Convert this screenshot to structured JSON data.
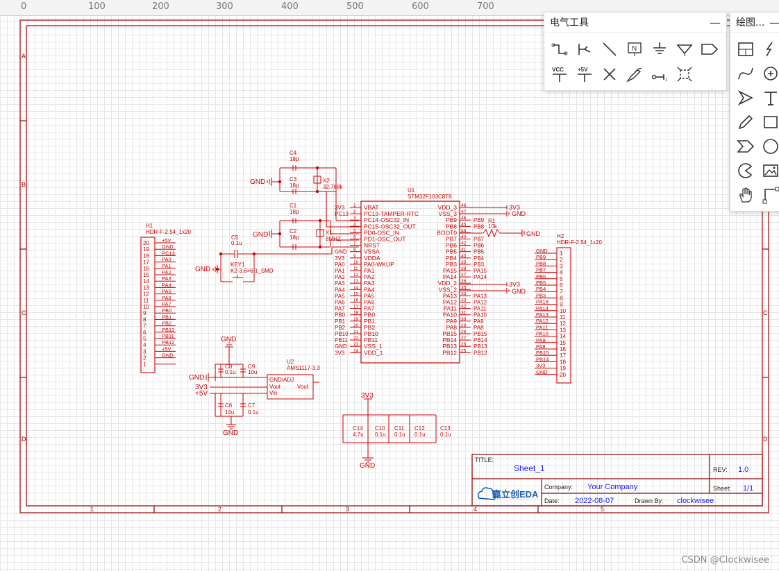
{
  "ruler": {
    "labels": [
      "0",
      "100",
      "200",
      "300",
      "400",
      "500",
      "600",
      "700"
    ]
  },
  "frame": {
    "rows": [
      "A",
      "B",
      "C",
      "D"
    ],
    "cols": [
      "1",
      "2",
      "3",
      "4",
      "5"
    ]
  },
  "title_block": {
    "title_label": "TITLE:",
    "title": "Sheet_1",
    "rev_label": "REV:",
    "rev": "1.0",
    "company_label": "Company:",
    "company": "Your Company",
    "sheet_label": "Sheet:",
    "sheet": "1/1",
    "date_label": "Date:",
    "date": "2022-08-07",
    "drawn_label": "Drawn By:",
    "drawn": "clockwisee",
    "logo": "嘉立创EDA"
  },
  "u1": {
    "ref": "U1",
    "part": "STM32F103C8T6",
    "left_pins": [
      {
        "num": "1",
        "name": "VBAT",
        "net": "3V3"
      },
      {
        "num": "2",
        "name": "PC13-TAMPER-RTC",
        "net": "PC13"
      },
      {
        "num": "3",
        "name": "PC14-OSC32_IN",
        "net": ""
      },
      {
        "num": "4",
        "name": "PC15-OSC32_OUT",
        "net": ""
      },
      {
        "num": "5",
        "name": "PD0-OSC_IN",
        "net": ""
      },
      {
        "num": "6",
        "name": "PD1-OSC_OUT",
        "net": ""
      },
      {
        "num": "7",
        "name": "NRST",
        "net": ""
      },
      {
        "num": "8",
        "name": "VSSA",
        "net": "GND"
      },
      {
        "num": "9",
        "name": "VDDA",
        "net": "3V3"
      },
      {
        "num": "10",
        "name": "PA0-WKUP",
        "net": "PA0"
      },
      {
        "num": "11",
        "name": "PA1",
        "net": "PA1"
      },
      {
        "num": "12",
        "name": "PA2",
        "net": "PA2"
      },
      {
        "num": "13",
        "name": "PA3",
        "net": "PA3"
      },
      {
        "num": "14",
        "name": "PA4",
        "net": "PA4"
      },
      {
        "num": "15",
        "name": "PA5",
        "net": "PA5"
      },
      {
        "num": "16",
        "name": "PA6",
        "net": "PA6"
      },
      {
        "num": "17",
        "name": "PA7",
        "net": "PA7"
      },
      {
        "num": "18",
        "name": "PB0",
        "net": "PB0"
      },
      {
        "num": "19",
        "name": "PB1",
        "net": "PB1"
      },
      {
        "num": "20",
        "name": "PB2",
        "net": "PB2"
      },
      {
        "num": "21",
        "name": "PB10",
        "net": "PB10"
      },
      {
        "num": "22",
        "name": "PB11",
        "net": "PB11"
      },
      {
        "num": "23",
        "name": "VSS_1",
        "net": "GND"
      },
      {
        "num": "24",
        "name": "VDD_1",
        "net": "3V3"
      }
    ],
    "right_pins": [
      {
        "num": "48",
        "name": "VDD_3",
        "net": "3V3"
      },
      {
        "num": "47",
        "name": "VSS_3",
        "net": "GND"
      },
      {
        "num": "46",
        "name": "PB9",
        "net": "PB9"
      },
      {
        "num": "45",
        "name": "PB8",
        "net": "PB8"
      },
      {
        "num": "44",
        "name": "BOOT0",
        "net": ""
      },
      {
        "num": "43",
        "name": "PB7",
        "net": "PB7"
      },
      {
        "num": "42",
        "name": "PB6",
        "net": "PB6"
      },
      {
        "num": "41",
        "name": "PB5",
        "net": "PB5"
      },
      {
        "num": "40",
        "name": "PB4",
        "net": "PB4"
      },
      {
        "num": "39",
        "name": "PB3",
        "net": "PB3"
      },
      {
        "num": "38",
        "name": "PA15",
        "net": "PA15"
      },
      {
        "num": "37",
        "name": "PA14",
        "net": "PA14"
      },
      {
        "num": "36",
        "name": "VDD_2",
        "net": "3V3"
      },
      {
        "num": "35",
        "name": "VSS_2",
        "net": "GND"
      },
      {
        "num": "34",
        "name": "PA13",
        "net": "PA13"
      },
      {
        "num": "33",
        "name": "PA12",
        "net": "PA12"
      },
      {
        "num": "32",
        "name": "PA11",
        "net": "PA11"
      },
      {
        "num": "31",
        "name": "PA10",
        "net": "PA10"
      },
      {
        "num": "30",
        "name": "PA9",
        "net": "PA9"
      },
      {
        "num": "29",
        "name": "PA8",
        "net": "PA8"
      },
      {
        "num": "28",
        "name": "PB15",
        "net": "PB15"
      },
      {
        "num": "27",
        "name": "PB14",
        "net": "PB14"
      },
      {
        "num": "26",
        "name": "PB13",
        "net": "PB13"
      },
      {
        "num": "25",
        "name": "PB12",
        "net": "PB12"
      }
    ]
  },
  "h1": {
    "ref": "H1",
    "part": "HDR-F-2.54_1x20",
    "pins": [
      {
        "num": "20",
        "net": "+5V"
      },
      {
        "num": "19",
        "net": "GND"
      },
      {
        "num": "18",
        "net": "PC13"
      },
      {
        "num": "17",
        "net": "PA0"
      },
      {
        "num": "16",
        "net": "PA1"
      },
      {
        "num": "15",
        "net": "PA2"
      },
      {
        "num": "14",
        "net": "PA3"
      },
      {
        "num": "13",
        "net": "PA4"
      },
      {
        "num": "12",
        "net": "PA5"
      },
      {
        "num": "11",
        "net": "PA6"
      },
      {
        "num": "10",
        "net": "PA7"
      },
      {
        "num": "9",
        "net": "PB0"
      },
      {
        "num": "8",
        "net": "PB1"
      },
      {
        "num": "7",
        "net": "PB2"
      },
      {
        "num": "6",
        "net": "PB10"
      },
      {
        "num": "5",
        "net": "PB11"
      },
      {
        "num": "4",
        "net": "PB12"
      },
      {
        "num": "3",
        "net": "+5V"
      },
      {
        "num": "2",
        "net": "GND"
      },
      {
        "num": "1",
        "net": ""
      }
    ]
  },
  "h2": {
    "ref": "H2",
    "part": "HDR-F-2.54_1x20",
    "pins": [
      {
        "num": "1",
        "net": "GND"
      },
      {
        "num": "2",
        "net": "PB9"
      },
      {
        "num": "3",
        "net": "PB8"
      },
      {
        "num": "4",
        "net": "PB7"
      },
      {
        "num": "5",
        "net": "PB6"
      },
      {
        "num": "6",
        "net": "PB5"
      },
      {
        "num": "7",
        "net": "PB4"
      },
      {
        "num": "8",
        "net": "PB3"
      },
      {
        "num": "9",
        "net": "PA15"
      },
      {
        "num": "10",
        "net": "PA14"
      },
      {
        "num": "11",
        "net": "PA13"
      },
      {
        "num": "12",
        "net": "PA12"
      },
      {
        "num": "13",
        "net": "PA11"
      },
      {
        "num": "14",
        "net": "PA10"
      },
      {
        "num": "15",
        "net": "PA9"
      },
      {
        "num": "16",
        "net": "PA8"
      },
      {
        "num": "17",
        "net": "PB15"
      },
      {
        "num": "18",
        "net": "PB14"
      },
      {
        "num": "19",
        "net": "3V3"
      },
      {
        "num": "20",
        "net": "GND"
      }
    ]
  },
  "parts": {
    "c4": {
      "ref": "C4",
      "val": "18p"
    },
    "c3": {
      "ref": "C3",
      "val": "18p"
    },
    "x2": {
      "ref": "X2",
      "val": "32.768k"
    },
    "c1": {
      "ref": "C1",
      "val": "18p"
    },
    "c2": {
      "ref": "C2",
      "val": "18p"
    },
    "x1": {
      "ref": "X1",
      "val": "8MHZ"
    },
    "c5": {
      "ref": "C5",
      "val": "0.1u"
    },
    "key1": {
      "ref": "KEY1",
      "val": "K2-3.6×6.1_SMD"
    },
    "r1": {
      "ref": "R1",
      "val": "10k"
    },
    "u2": {
      "ref": "U2",
      "val": "AMS1117-3.3",
      "pin1": "GND/ADJ",
      "pin2": "Vout",
      "pin3": "Vin",
      "pin4": "Vout"
    },
    "c8": {
      "ref": "C8",
      "val": "0.1u"
    },
    "c9": {
      "ref": "C9",
      "val": "10u"
    },
    "c6": {
      "ref": "C6",
      "val": "10u"
    },
    "c7": {
      "ref": "C7",
      "val": "0.1u"
    },
    "c14": {
      "ref": "C14",
      "val": "4.7u"
    },
    "c10": {
      "ref": "C10",
      "val": "0.1u"
    },
    "c11": {
      "ref": "C11",
      "val": "0.1u"
    },
    "c12": {
      "ref": "C12",
      "val": "0.1u"
    },
    "c13": {
      "ref": "C13",
      "val": "0.1u"
    }
  },
  "nets": {
    "gnd": "GND",
    "v33": "3V3",
    "v5": "+5V",
    "boot0": "BOOT0",
    "pb2": "PB2"
  },
  "electrical_panel": {
    "title": "电气工具",
    "minimize": "—",
    "tools": [
      {
        "icon": "wire-icon"
      },
      {
        "icon": "bus-icon"
      },
      {
        "icon": "line-icon"
      },
      {
        "icon": "net-label-icon",
        "text": "N"
      },
      {
        "icon": "ground-icon"
      },
      {
        "icon": "net-port-icon"
      },
      {
        "icon": "net-flag-icon"
      },
      {
        "icon": "vcc-icon",
        "text": "VCC"
      },
      {
        "icon": "plus5v-icon",
        "text": "+5V"
      },
      {
        "icon": "no-connect-icon"
      },
      {
        "icon": "probe-icon"
      },
      {
        "icon": "pin-icon"
      },
      {
        "icon": "component-icon"
      }
    ]
  },
  "drawing_panel": {
    "title": "绘图...",
    "minimize": "—"
  },
  "watermark": "CSDN @Clockwisee",
  "colors": {
    "schematic": "#cc0000",
    "value": "#cc0000",
    "title_value": "#1a1aff",
    "frame": "#990000"
  }
}
